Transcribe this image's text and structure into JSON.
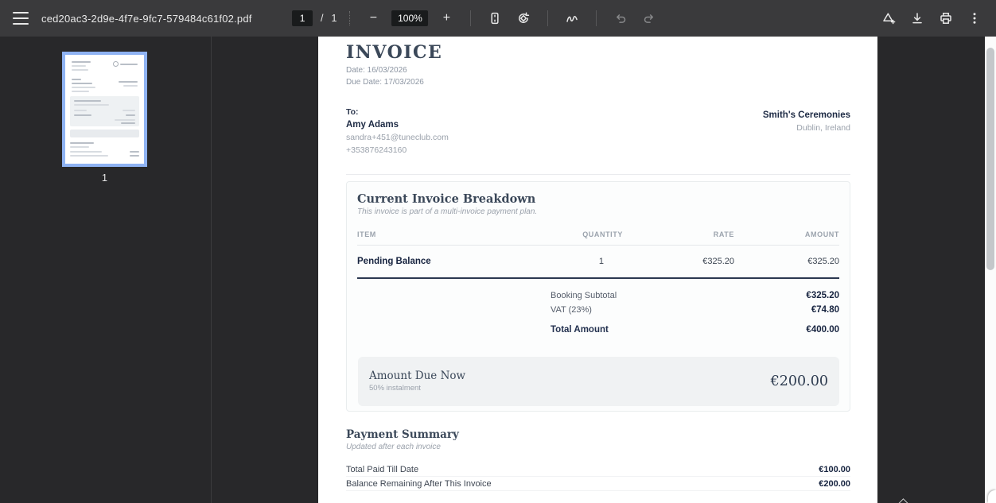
{
  "toolbar": {
    "filename": "ced20ac3-2d9e-4f7e-9fc7-579484c61f02.pdf",
    "page_current": "1",
    "page_separator": "/",
    "page_total": "1",
    "zoom_out_glyph": "−",
    "zoom_level": "100%",
    "zoom_in_glyph": "+"
  },
  "sidebar": {
    "thumbnail_page_label": "1"
  },
  "invoice": {
    "title": "INVOICE",
    "date_line": "Date: 16/03/2026",
    "due_date_line": "Due Date: 17/03/2026",
    "to_label": "To:",
    "recipient_name": "Amy Adams",
    "recipient_email": "sandra+451@tuneclub.com",
    "recipient_phone": "+353876243160",
    "company_name": "Smith's Ceremonies",
    "company_location": "Dublin, Ireland",
    "breakdown": {
      "title": "Current Invoice Breakdown",
      "subtitle": "This invoice is part of a multi-invoice payment plan.",
      "table": {
        "headers": [
          "ITEM",
          "QUANTITY",
          "RATE",
          "AMOUNT"
        ],
        "rows": [
          {
            "item": "Pending Balance",
            "quantity": "1",
            "rate": "€325.20",
            "amount": "€325.20"
          }
        ]
      },
      "totals": [
        {
          "label": "Booking Subtotal",
          "value": "€325.20"
        },
        {
          "label": "VAT (23%)",
          "value": "€74.80"
        },
        {
          "label": "Total Amount",
          "value": "€400.00"
        }
      ],
      "amount_due": {
        "title": "Amount Due Now",
        "subtitle": "50% instalment",
        "value": "€200.00"
      }
    },
    "payment_summary": {
      "title": "Payment Summary",
      "subtitle": "Updated after each invoice",
      "rows": [
        {
          "label": "Total Paid Till Date",
          "value": "€100.00"
        },
        {
          "label": "Balance Remaining After This Invoice",
          "value": "€200.00"
        }
      ]
    }
  },
  "colors": {
    "toolbar_bg": "#3a3a3c",
    "viewer_bg": "#28282a",
    "thumbnail_selection_blue": "#8fb3f3",
    "heading_navy": "#3b4859",
    "table_rule_dark": "#2b3850"
  }
}
